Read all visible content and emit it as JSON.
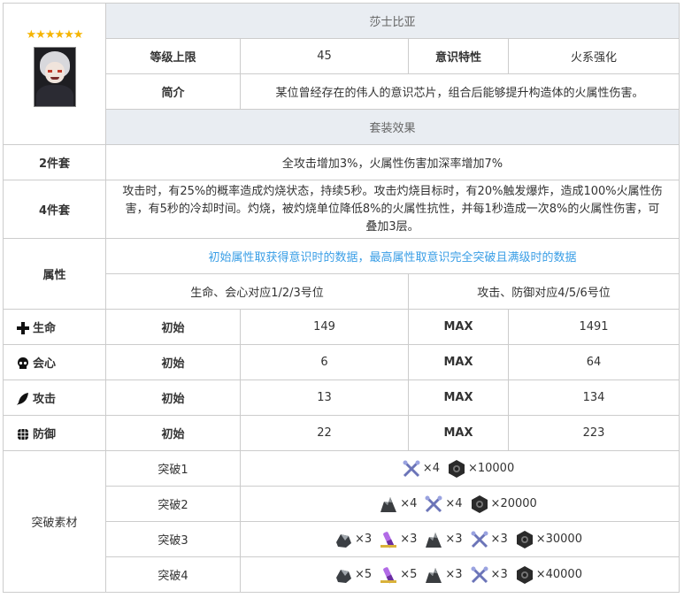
{
  "rarity_stars": "★★★★★★",
  "name": "莎士比亚",
  "level_cap_label": "等级上限",
  "level_cap_value": "45",
  "trait_label": "意识特性",
  "trait_value": "火系强化",
  "intro_label": "简介",
  "intro_text": "某位曾经存在的伟人的意识芯片，组合后能够提升构造体的火属性伤害。",
  "set_effect_header": "套装效果",
  "set2_label": "2件套",
  "set2_text": "全攻击增加3%，火属性伤害加深率增加7%",
  "set4_label": "4件套",
  "set4_text": "攻击时，有25%的概率造成灼烧状态，持续5秒。攻击灼烧目标时，有20%触发爆炸，造成100%火属性伤害，有5秒的冷却时间。灼烧，被灼烧单位降低8%的火属性抗性，并每1秒造成一次8%的火属性伤害，可叠加3层。",
  "attr_label": "属性",
  "attr_note": "初始属性取获得意识时的数据，最高属性取意识完全突破且满级时的数据",
  "attr_left_note": "生命、会心对应1/2/3号位",
  "attr_right_note": "攻击、防御对应4/5/6号位",
  "init_label": "初始",
  "max_label": "MAX",
  "stats": [
    {
      "name": "生命",
      "icon": "cross-icon",
      "init": "149",
      "max": "1491"
    },
    {
      "name": "会心",
      "icon": "skull-icon",
      "init": "6",
      "max": "64"
    },
    {
      "name": "攻击",
      "icon": "feather-icon",
      "init": "13",
      "max": "134"
    },
    {
      "name": "防御",
      "icon": "shield-icon",
      "init": "22",
      "max": "223"
    }
  ],
  "breakthrough_label": "突破素材",
  "breakthroughs": [
    {
      "label": "突破1",
      "items": [
        {
          "icon": "scissors-icon",
          "count": "×4"
        },
        {
          "icon": "nut-icon",
          "count": "×10000"
        }
      ]
    },
    {
      "label": "突破2",
      "items": [
        {
          "icon": "ore-icon",
          "count": "×4"
        },
        {
          "icon": "scissors-icon",
          "count": "×4"
        },
        {
          "icon": "nut-icon",
          "count": "×20000"
        }
      ]
    },
    {
      "label": "突破3",
      "items": [
        {
          "icon": "gear-stone-icon",
          "count": "×3"
        },
        {
          "icon": "vial-icon",
          "count": "×3"
        },
        {
          "icon": "ore-icon",
          "count": "×3"
        },
        {
          "icon": "scissors-icon",
          "count": "×3"
        },
        {
          "icon": "nut-icon",
          "count": "×30000"
        }
      ]
    },
    {
      "label": "突破4",
      "items": [
        {
          "icon": "gear-stone-icon",
          "count": "×5"
        },
        {
          "icon": "vial-icon",
          "count": "×5"
        },
        {
          "icon": "ore-icon",
          "count": "×3"
        },
        {
          "icon": "scissors-icon",
          "count": "×3"
        },
        {
          "icon": "nut-icon",
          "count": "×40000"
        }
      ]
    }
  ]
}
